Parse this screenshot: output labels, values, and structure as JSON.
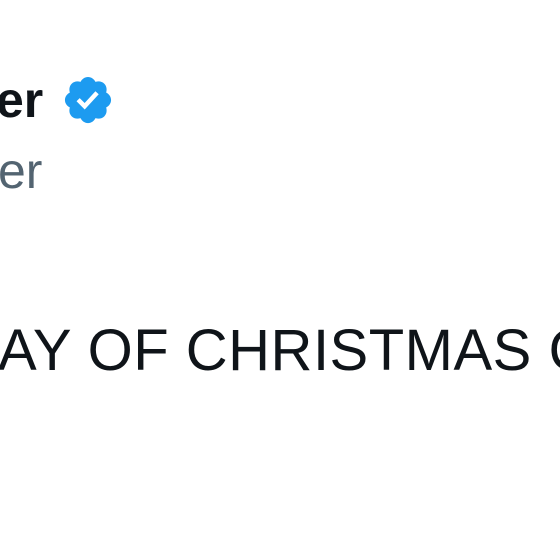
{
  "author": {
    "display_name_visible": "er",
    "handle_visible": "er",
    "verified": true,
    "verified_color": "#1d9bf0"
  },
  "tweet": {
    "text_visible": "AY OF CHRISTMAS C"
  },
  "colors": {
    "text_primary": "#0f1419",
    "text_secondary": "#536471",
    "background": "#ffffff"
  }
}
